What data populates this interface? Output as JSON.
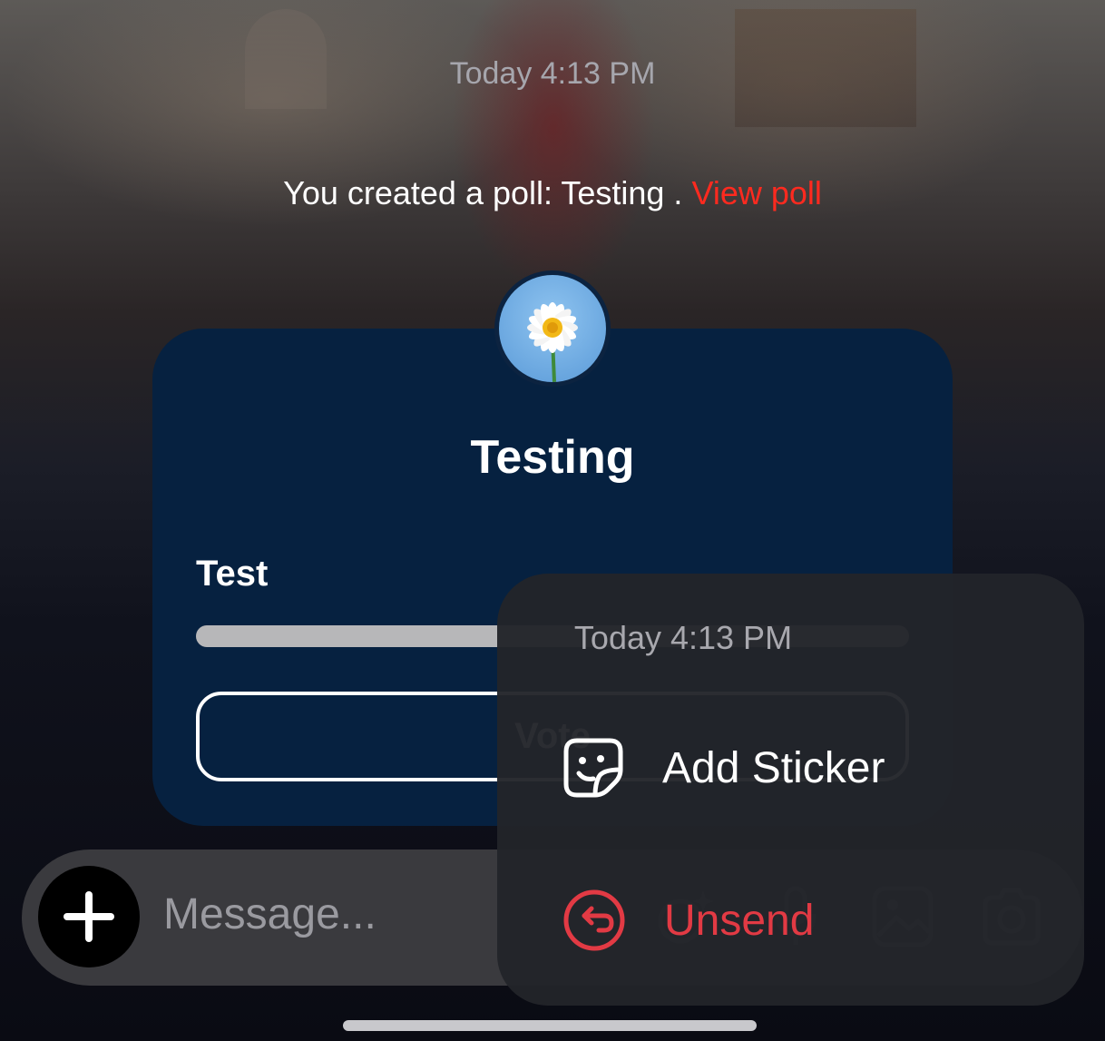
{
  "conversation": {
    "timestamp": "Today 4:13 PM",
    "poll_notice": {
      "text": "You created a poll: Testing .",
      "link": "View poll"
    }
  },
  "poll": {
    "title": "Testing",
    "option": {
      "label": "Test",
      "vote_fraction": 1.0
    },
    "vote_button": "Vote"
  },
  "composer": {
    "placeholder": "Message..."
  },
  "context_menu": {
    "timestamp": "Today 4:13 PM",
    "items": [
      {
        "label": "Add Sticker",
        "icon": "sticker-icon",
        "color": "#ffffff"
      },
      {
        "label": "Unsend",
        "icon": "unsend-icon",
        "color": "#e23a44"
      }
    ]
  },
  "colors": {
    "accent_link": "#ff2a1f",
    "poll_card": "#062140",
    "destructive": "#e23a44"
  }
}
